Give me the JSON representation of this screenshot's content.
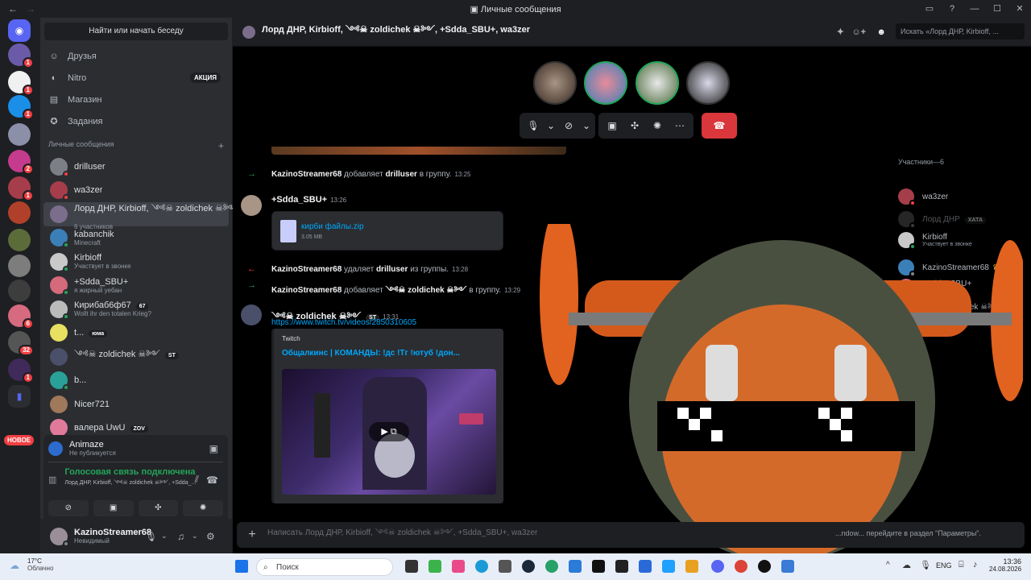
{
  "window": {
    "title": "Личные сообщения",
    "back": "←",
    "forward": "→"
  },
  "servers": {
    "new_label": "НОВОЕ",
    "badges": [
      "1",
      "1",
      "1",
      "2",
      "1",
      "6",
      "32",
      "1"
    ]
  },
  "sidebar": {
    "search_button": "Найти или начать беседу",
    "menu": [
      {
        "label": "Друзья",
        "icon": "friends-icon"
      },
      {
        "label": "Nitro",
        "icon": "nitro-icon",
        "promo": "АКЦИЯ"
      },
      {
        "label": "Магазин",
        "icon": "shop-icon"
      },
      {
        "label": "Задания",
        "icon": "quests-icon"
      }
    ],
    "dm_header": "Личные сообщения",
    "dm_add": "+",
    "dms": [
      {
        "name": "drilluser",
        "sub": ""
      },
      {
        "name": "wa3zer",
        "sub": ""
      },
      {
        "name": "Лорд ДНР, Kirbioff, ༺☠ zoldichek ☠༻",
        "sub": "6 участников"
      },
      {
        "name": "kabanchik",
        "sub": "Minecraft"
      },
      {
        "name": "Kirbioff",
        "sub": "Участвует в звонке"
      },
      {
        "name": "+Sdda_SBU+",
        "sub": "я жирный уебан"
      },
      {
        "name": "Кирибаб6ф67",
        "sub": "Wollt ihr den totalen Krieg?",
        "tag": "67"
      },
      {
        "name": "t...",
        "sub": "",
        "tag": "юма"
      },
      {
        "name": "༺☠ zoldichek ☠༻",
        "sub": "",
        "tag": "ST"
      },
      {
        "name": "b...",
        "sub": ""
      },
      {
        "name": "Nicer721",
        "sub": ""
      },
      {
        "name": "валера UwU",
        "sub": "",
        "tag": "ZOV"
      }
    ]
  },
  "panel": {
    "app_name": "Animaze",
    "app_sub": "Не публикуется",
    "voice_title": "Голосовая связь подключена",
    "voice_sub": "Лорд ДНР, Kirbioff, ༺☠ zoldichek ☠༻, +Sdda_..."
  },
  "user": {
    "name": "KazinoStreamer68",
    "status": "Невидимый"
  },
  "chat": {
    "header_title": "Лорд ДНР, Kirbioff, ༺☠ zoldichek ☠༻, +Sdda_SBU+, wa3zer",
    "search_placeholder": "Искать «Лорд ДНР, Kirbioff, ...",
    "messages": [
      {
        "type": "system",
        "arrow": "→",
        "actor": "KazinoStreamer68",
        "action": "добавляет",
        "target": "drilluser",
        "tail": "в группу.",
        "time": "13:25"
      },
      {
        "type": "system",
        "arrow": "←",
        "actor": "KazinoStreamer68",
        "action": "удаляет",
        "target": "drilluser",
        "tail": "из группы.",
        "time": "13:28"
      },
      {
        "type": "system",
        "arrow": "→",
        "actor": "KazinoStreamer68",
        "action": "добавляет",
        "target": "༺☠ zoldichek ☠༻",
        "tail": "в группу.",
        "time": "13:29"
      }
    ],
    "file_msg": {
      "author": "+Sdda_SBU+",
      "time": "13:26",
      "file_name": "кирби файлы.zip",
      "file_size": "3.05 MB"
    },
    "link_msg": {
      "author": "༺☠ zoldichek ☠༻",
      "tag": "ST",
      "time": "13:31",
      "url": "https://www.twitch.tv/videos/2850310605",
      "embed_provider": "Twitch",
      "embed_title": "Общалкинс | КОМАНДЫ: !дс !Тг !ютуб !дон..."
    },
    "composer_placeholder": "Написать Лорд ДНР, Kirbioff, ༺☠ zoldichek ☠༻, +Sdda_SBU+, wa3zer",
    "watermark": "...ndow... перейдите в раздел \"Параметры\"."
  },
  "members": {
    "header": "Участники—6",
    "list": [
      {
        "name": "wa3zer",
        "sub": ""
      },
      {
        "name": "Лорд ДНР",
        "sub": "",
        "tag": "ХАТА",
        "dim": true
      },
      {
        "name": "Kirbioff",
        "sub": "Участвует в звонке"
      },
      {
        "name": "KazinoStreamer68",
        "sub": "",
        "crown": "♛"
      },
      {
        "name": "+Sdda_SBU+",
        "sub": "я жирный уебан"
      },
      {
        "name": "༺☠ zoldichek ☠༻",
        "sub": ""
      }
    ]
  },
  "taskbar": {
    "weather_temp": "17°C",
    "weather_desc": "Облачно",
    "search": "Поиск",
    "lang": "ENG",
    "time": "13:36",
    "date": "24.08.2026"
  },
  "colors": {
    "accent": "#5865f2",
    "online": "#23a55a",
    "dnd": "#f23f43",
    "link": "#00a8fc",
    "hangup": "#da373c"
  }
}
